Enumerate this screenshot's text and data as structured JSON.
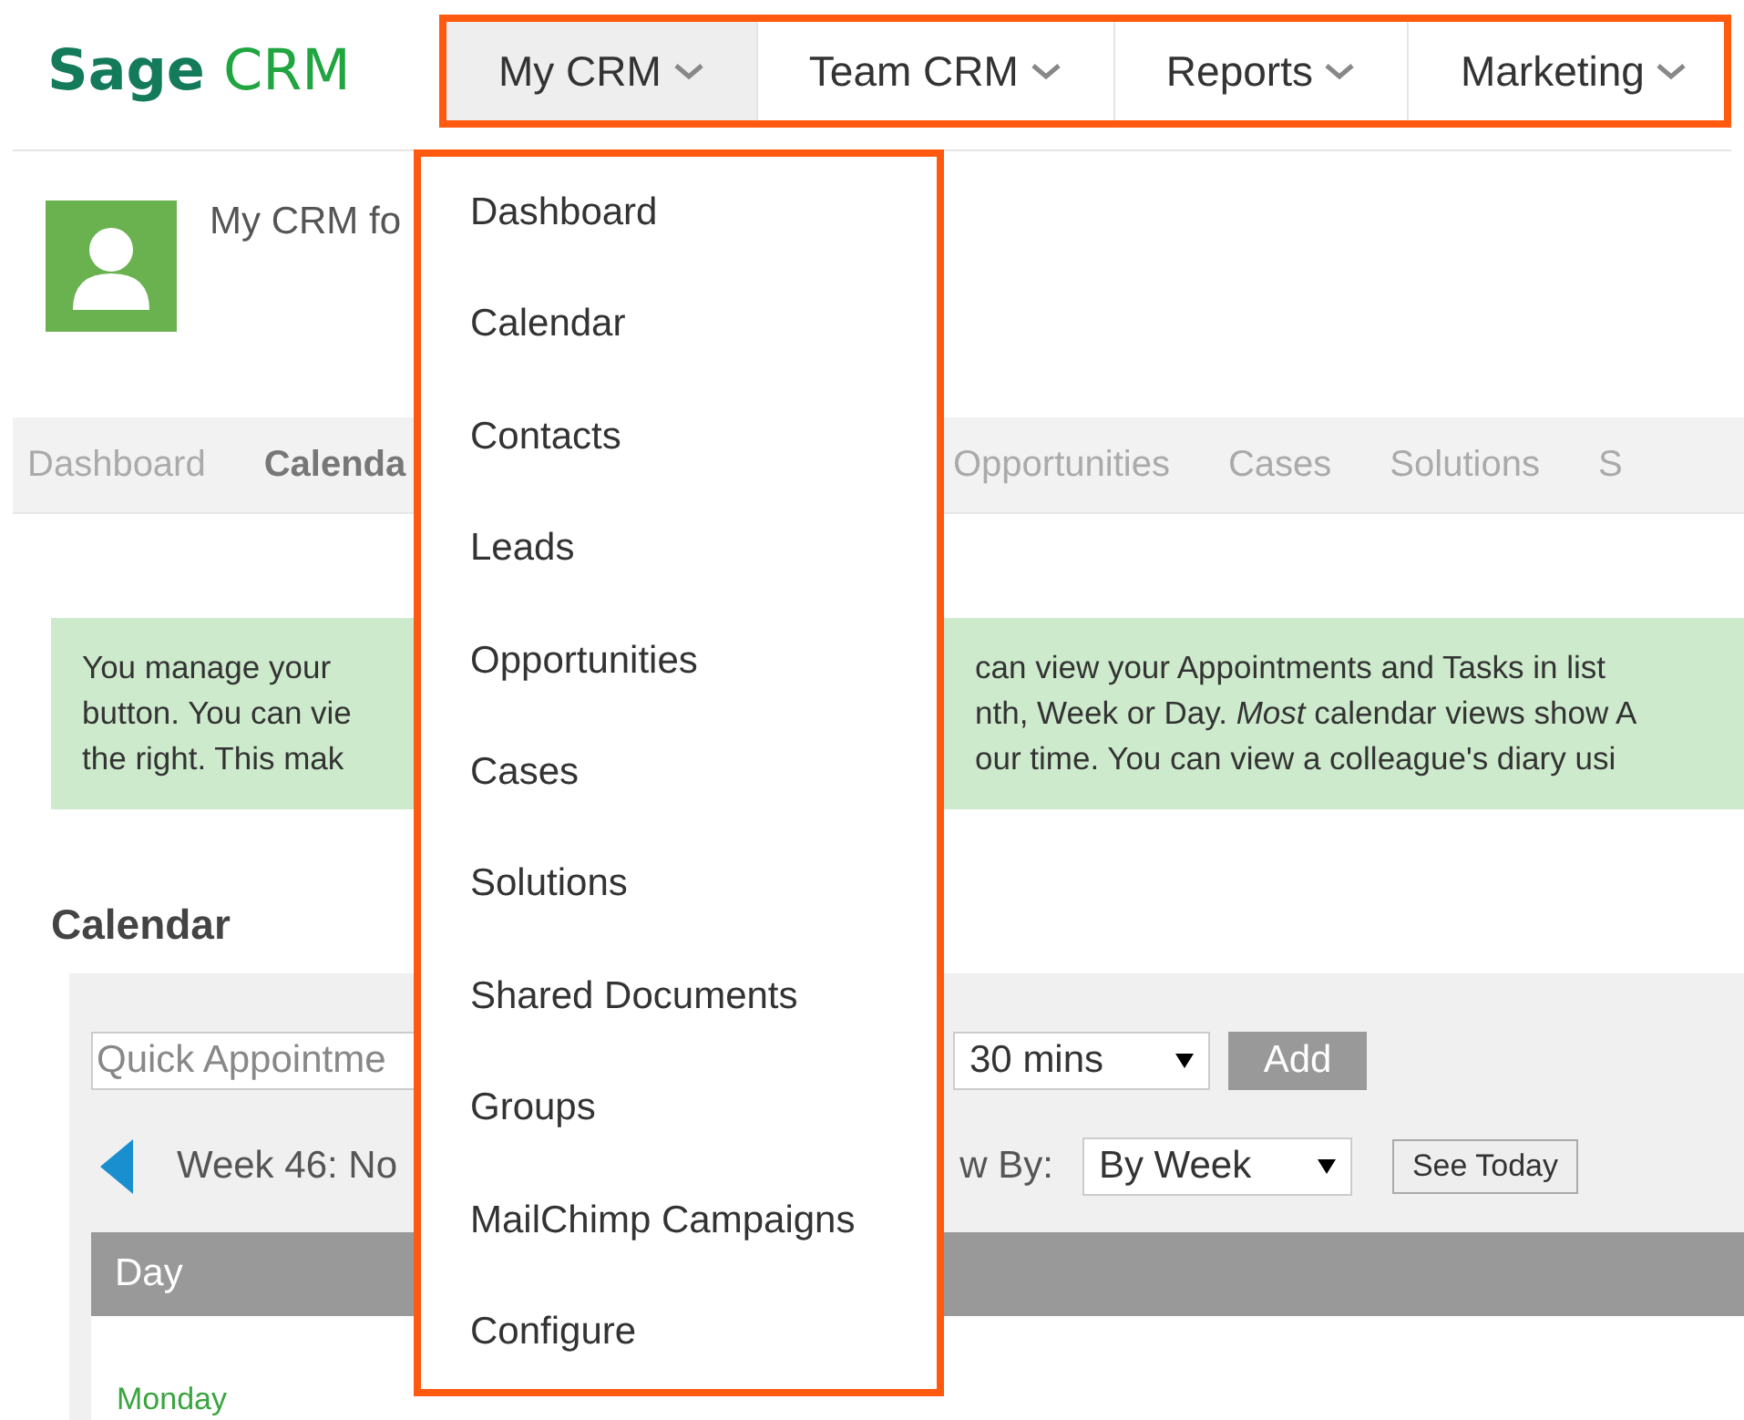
{
  "logo": {
    "part_1": "Sage",
    "part_2": "CRM"
  },
  "nav": [
    {
      "label": "My CRM",
      "selected": true
    },
    {
      "label": "Team CRM",
      "selected": false
    },
    {
      "label": "Reports",
      "selected": false
    },
    {
      "label": "Marketing",
      "selected": false
    }
  ],
  "user_title": "My CRM fo",
  "tabs_left": [
    {
      "label": "Dashboard",
      "selected": false
    },
    {
      "label": "Calenda",
      "selected": true
    }
  ],
  "tabs_right": [
    {
      "label": "Opportunities",
      "selected": false
    },
    {
      "label": "Cases",
      "selected": false
    },
    {
      "label": "Solutions",
      "selected": false
    },
    {
      "label": "S",
      "selected": false
    }
  ],
  "info_lines": [
    {
      "left": "You manage your",
      "right": "can view your Appointments and Tasks in list"
    },
    {
      "left": "button. You can vie",
      "right": "nth, Week or Day. *Most* calendar views show A"
    },
    {
      "left": "the right. This mak",
      "right": "our time. You can view a colleague's diary usi"
    }
  ],
  "calendar": {
    "title": "Calendar",
    "quick_placeholder": "Quick Appointme",
    "duration": "30 mins",
    "add": "Add",
    "week": "Week 46: No",
    "view_by_label": "w By:",
    "view_by": "By Week",
    "see_today": "See Today",
    "column": "Day",
    "first_day": "Monday"
  },
  "dropdown": {
    "items": [
      "Dashboard",
      "Calendar",
      "Contacts",
      "Leads",
      "Opportunities",
      "Cases",
      "Solutions",
      "Shared Documents",
      "Groups",
      "MailChimp Campaigns",
      "Configure"
    ]
  }
}
